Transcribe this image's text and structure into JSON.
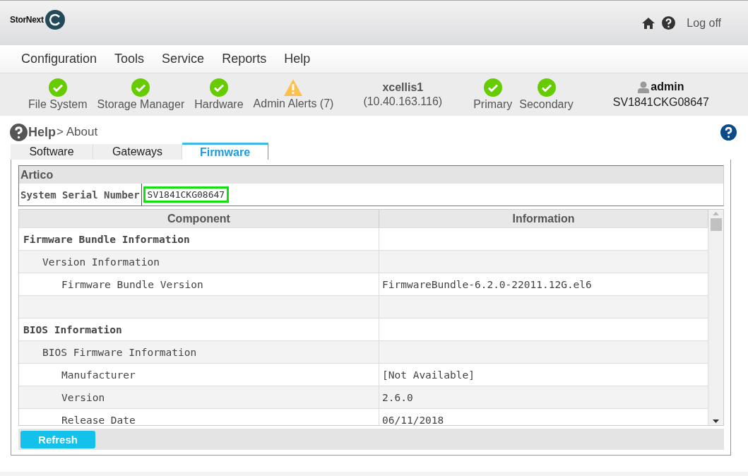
{
  "header": {
    "logo_text": "StorNext",
    "logoff": "Log off"
  },
  "menu": [
    "Configuration",
    "Tools",
    "Service",
    "Reports",
    "Help"
  ],
  "status": [
    {
      "label": "File System",
      "kind": "ok"
    },
    {
      "label": "Storage Manager",
      "kind": "ok"
    },
    {
      "label": "Hardware",
      "kind": "ok"
    },
    {
      "label": "Admin Alerts (7)",
      "kind": "warning"
    }
  ],
  "system": {
    "name": "xcellis1",
    "address": "(10.40.163.116)"
  },
  "nodes": [
    {
      "label": "Primary",
      "kind": "ok"
    },
    {
      "label": "Secondary",
      "kind": "ok"
    }
  ],
  "user": {
    "name": "admin",
    "serial": "SV1841CKG08647"
  },
  "breadcrumb": {
    "section": "Help",
    "page": "> About"
  },
  "tabs": [
    {
      "label": "Software",
      "selected": false
    },
    {
      "label": "Gateways",
      "selected": false
    },
    {
      "label": "Firmware",
      "selected": true
    }
  ],
  "system_box": {
    "title": "Artico",
    "serial_label": "System Serial Number",
    "serial_value": "SV1841CKG08647"
  },
  "table": {
    "columns": [
      "Component",
      "Information"
    ],
    "rows": [
      {
        "kind": "entry",
        "component": "Firmware Bundle Information",
        "children": [
          {
            "kind": "entry",
            "component": "Version Information",
            "children": [
              {
                "kind": "entry",
                "component": "Firmware Bundle Version",
                "information": "FirmwareBundle-6.2.0-22011.12G.el6"
              }
            ]
          }
        ]
      },
      {
        "kind": "blank"
      },
      {
        "kind": "entry",
        "component": "BIOS Information",
        "children": [
          {
            "kind": "entry",
            "component": "BIOS Firmware Information",
            "children": [
              {
                "kind": "entry",
                "component": "Manufacturer",
                "information": "[Not Available]"
              },
              {
                "kind": "entry",
                "component": "Version",
                "information": "2.6.0"
              },
              {
                "kind": "entry",
                "component": "Release Date",
                "information": "06/11/2018"
              }
            ]
          }
        ]
      }
    ]
  },
  "refresh_button": "Refresh"
}
